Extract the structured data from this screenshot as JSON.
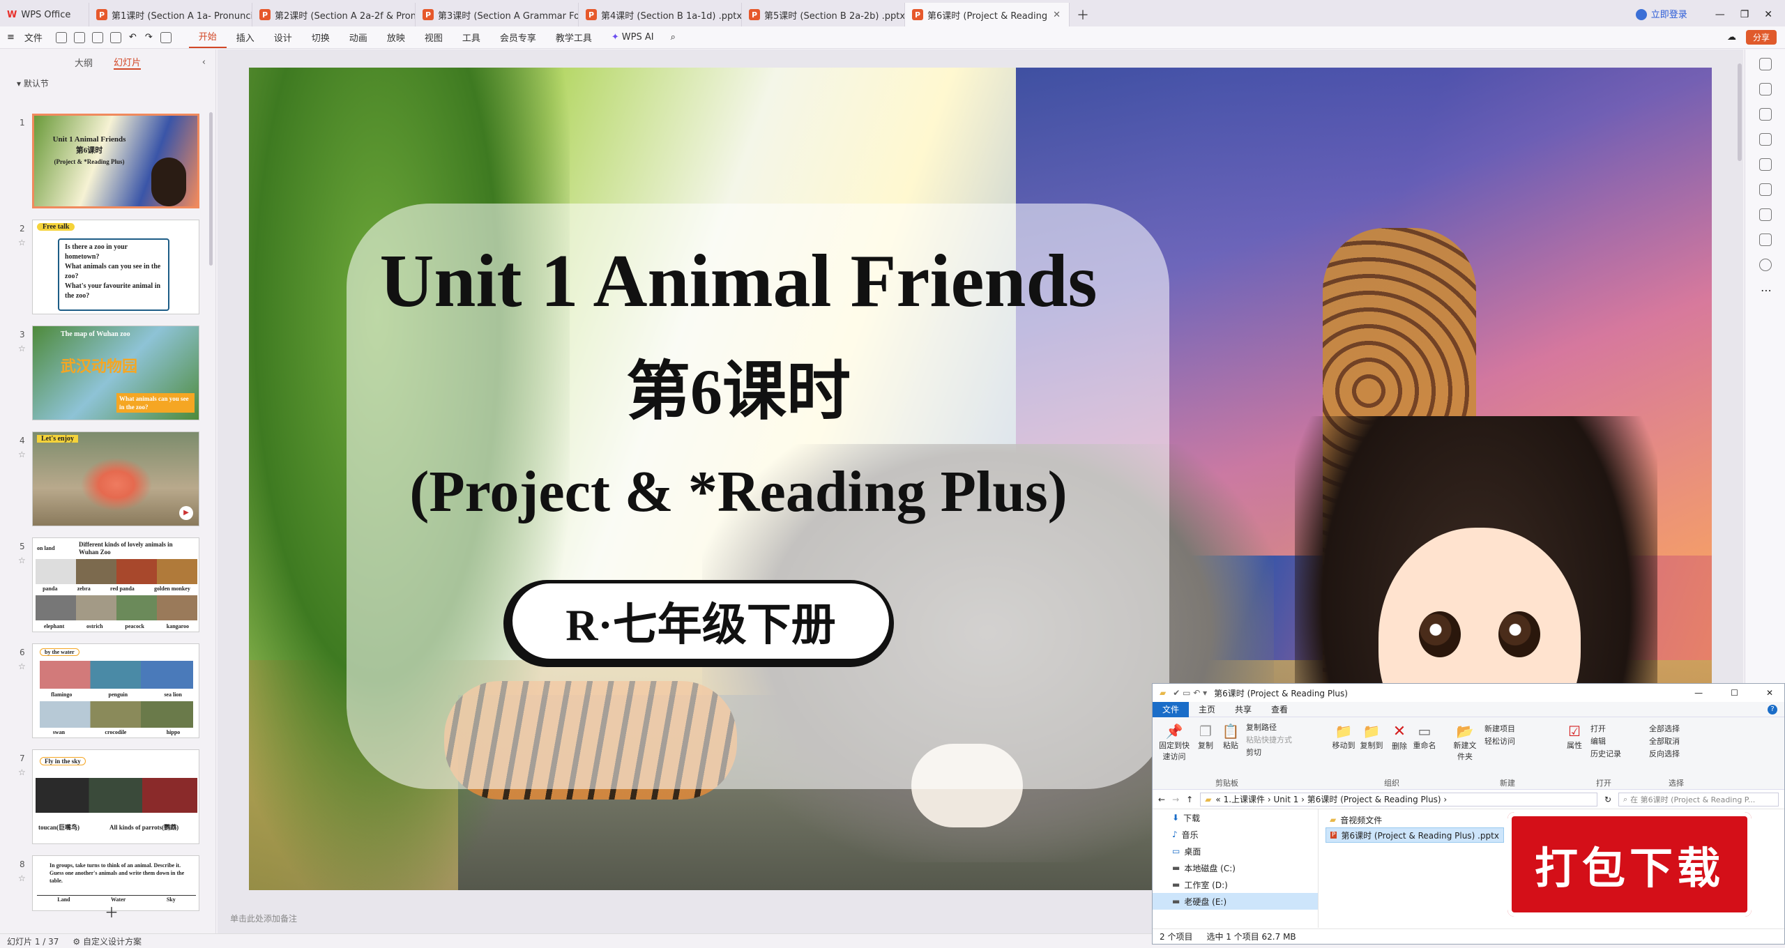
{
  "tabs": [
    {
      "label": "WPS Office",
      "type": "wps"
    },
    {
      "label": "第1课时 (Section A 1a- Pronunciati",
      "type": "ppt"
    },
    {
      "label": "第2课时 (Section A 2a-2f & Pronu",
      "type": "ppt"
    },
    {
      "label": "第3课时 (Section A Grammar Focu",
      "type": "ppt"
    },
    {
      "label": "第4课时 (Section B 1a-1d) .pptx",
      "type": "ppt"
    },
    {
      "label": "第5课时 (Section B 2a-2b) .pptx",
      "type": "ppt"
    },
    {
      "label": "第6课时 (Project & Reading",
      "type": "ppt",
      "active": true
    }
  ],
  "window_actions": {
    "login": "立即登录",
    "share": "分享"
  },
  "menu": {
    "file": "文件",
    "items": [
      "开始",
      "插入",
      "设计",
      "切换",
      "动画",
      "放映",
      "视图",
      "工具",
      "会员专享",
      "教学工具"
    ],
    "ai": "WPS AI"
  },
  "left_panel": {
    "tab_outline": "大纲",
    "tab_slides": "幻灯片",
    "section": "默认节"
  },
  "thumbs": [
    {
      "num": "1",
      "lines": [
        "Unit 1 Animal Friends",
        "第6课时",
        "(Project & *Reading Plus)"
      ]
    },
    {
      "num": "2",
      "lines": [
        "Free talk",
        "Is there a zoo in your hometown?",
        "What animals can you see in the zoo?",
        "What's your favourite animal in the zoo?"
      ]
    },
    {
      "num": "3",
      "lines": [
        "The map of Wuhan zoo",
        "武汉动物园",
        "What animals can you see in the zoo?"
      ]
    },
    {
      "num": "4",
      "lines": [
        "Let's enjoy"
      ]
    },
    {
      "num": "5",
      "lines": [
        "Different kinds of lovely animals in Wuhan Zoo",
        "on land",
        "panda",
        "zebra",
        "red panda",
        "golden monkey",
        "elephant",
        "ostrich",
        "peacock",
        "kangaroo"
      ]
    },
    {
      "num": "6",
      "lines": [
        "by the water",
        "flamingo",
        "penguin",
        "sea lion",
        "swan",
        "crocodile",
        "hippo"
      ]
    },
    {
      "num": "7",
      "lines": [
        "Fly in the sky",
        "toucan(巨嘴鸟)",
        "All kinds of parrots(鹦鹉)"
      ]
    },
    {
      "num": "8",
      "lines": [
        "In groups, take turns to think of an animal. Describe it. Guess one another's animals and write them down in the table.",
        "Land",
        "Water",
        "Sky"
      ]
    }
  ],
  "slide": {
    "title": "Unit 1 Animal Friends",
    "lesson": "第6课时",
    "subtitle": "(Project & *Reading Plus)",
    "badge": "R·七年级下册"
  },
  "notes_placeholder": "单击此处添加备注",
  "status": {
    "page": "幻灯片 1 / 37",
    "theme": "自定义设计方案"
  },
  "explorer": {
    "title": "第6课时 (Project & Reading Plus)",
    "tabs": [
      "文件",
      "主页",
      "共享",
      "查看"
    ],
    "ribbon": {
      "clipboard": [
        "固定到快速访问",
        "复制",
        "粘贴",
        "复制路径",
        "粘贴快捷方式",
        "剪切"
      ],
      "clipboard_group": "剪贴板",
      "organize": [
        "移动到",
        "复制到",
        "删除",
        "重命名"
      ],
      "organize_group": "组织",
      "new": [
        "新建文件夹",
        "新建项目",
        "轻松访问"
      ],
      "new_group": "新建",
      "open": [
        "属性",
        "打开",
        "编辑",
        "历史记录"
      ],
      "open_group": "打开",
      "select": [
        "全部选择",
        "全部取消",
        "反向选择"
      ],
      "select_group": "选择"
    },
    "path": [
      "1.上课课件",
      "Unit 1",
      "第6课时 (Project & Reading Plus)"
    ],
    "search_placeholder": "在 第6课时 (Project & Reading P...",
    "nav": [
      "下载",
      "音乐",
      "桌面",
      "本地磁盘 (C:)",
      "工作室 (D:)",
      "老硬盘 (E:)"
    ],
    "files": [
      "音视频文件",
      "第6课时 (Project & Reading Plus) .pptx"
    ],
    "status_count": "2 个项目",
    "status_sel": "选中 1 个项目  62.7 MB"
  },
  "download_label": "打包下载"
}
